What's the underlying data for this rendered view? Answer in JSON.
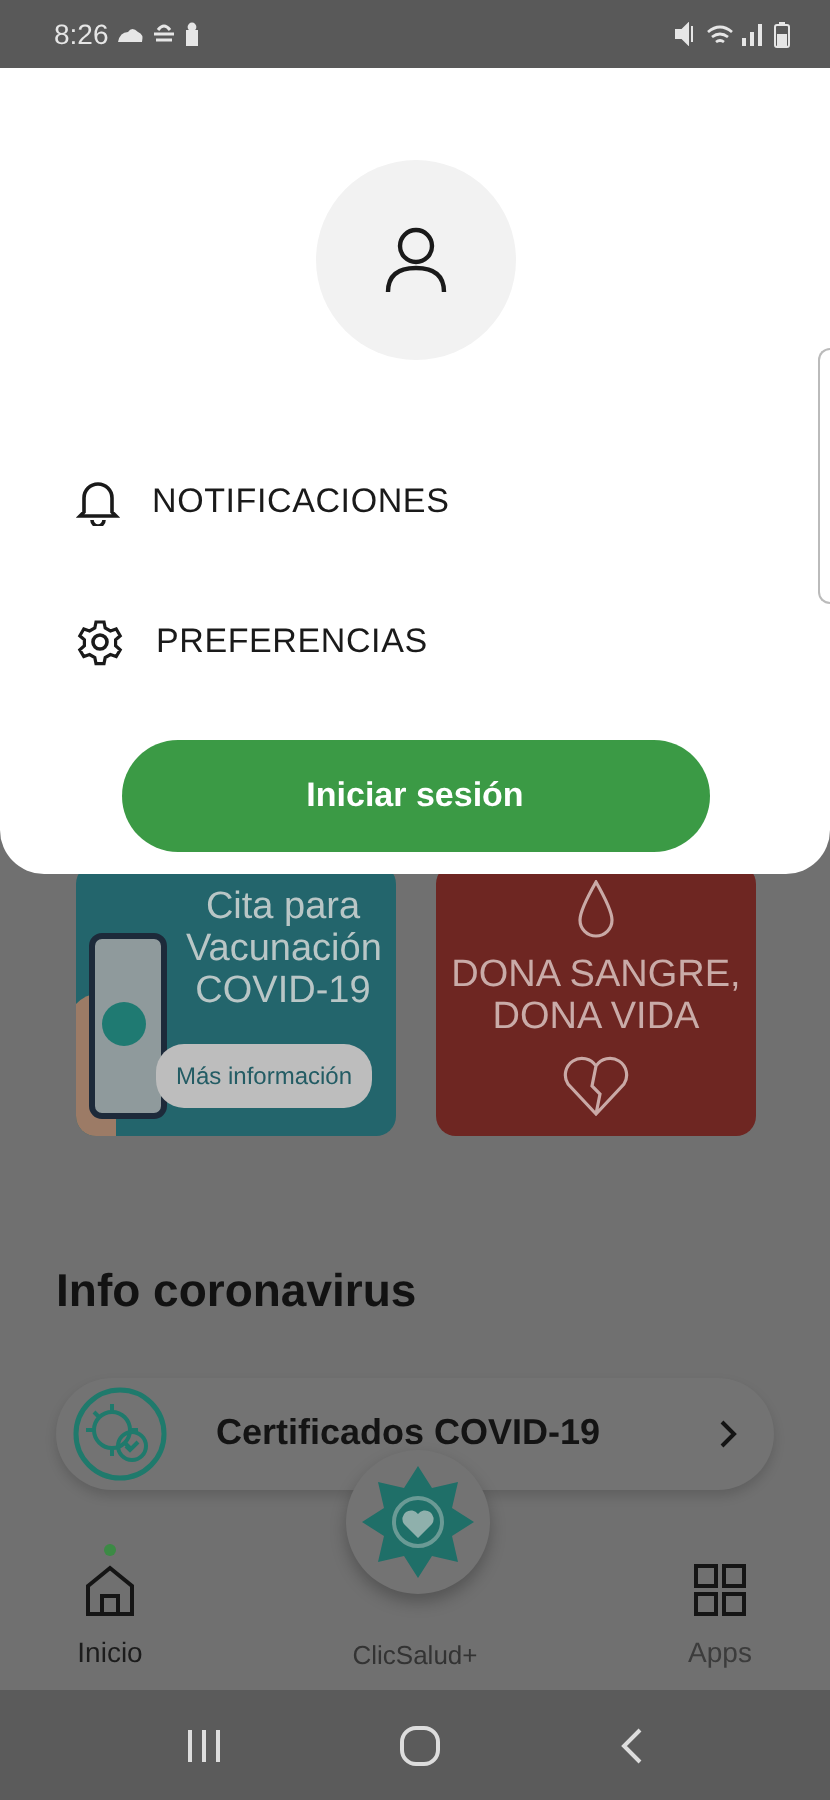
{
  "status_bar": {
    "time": "8:26"
  },
  "menu": {
    "items": [
      {
        "kind": "bell",
        "label": "NOTIFICACIONES"
      },
      {
        "kind": "gear",
        "label": "PREFERENCIAS"
      }
    ],
    "button": "Iniciar sesión"
  },
  "banners": [
    {
      "kind": "vaccine",
      "title": "Cita para Vacunación COVID-19",
      "button": "Más información"
    },
    {
      "kind": "blood",
      "title": "DONA SANGRE, DONA VIDA"
    }
  ],
  "section": {
    "title": "Info coronavirus",
    "items": [
      {
        "label": "Certificados COVID-19"
      }
    ]
  },
  "bottom_nav": [
    {
      "kind": "home",
      "label": "Inicio",
      "selected": true
    },
    {
      "kind": "center",
      "label": "ClicSalud+",
      "selected": false
    },
    {
      "kind": "apps",
      "label": "Apps",
      "selected": false
    }
  ]
}
